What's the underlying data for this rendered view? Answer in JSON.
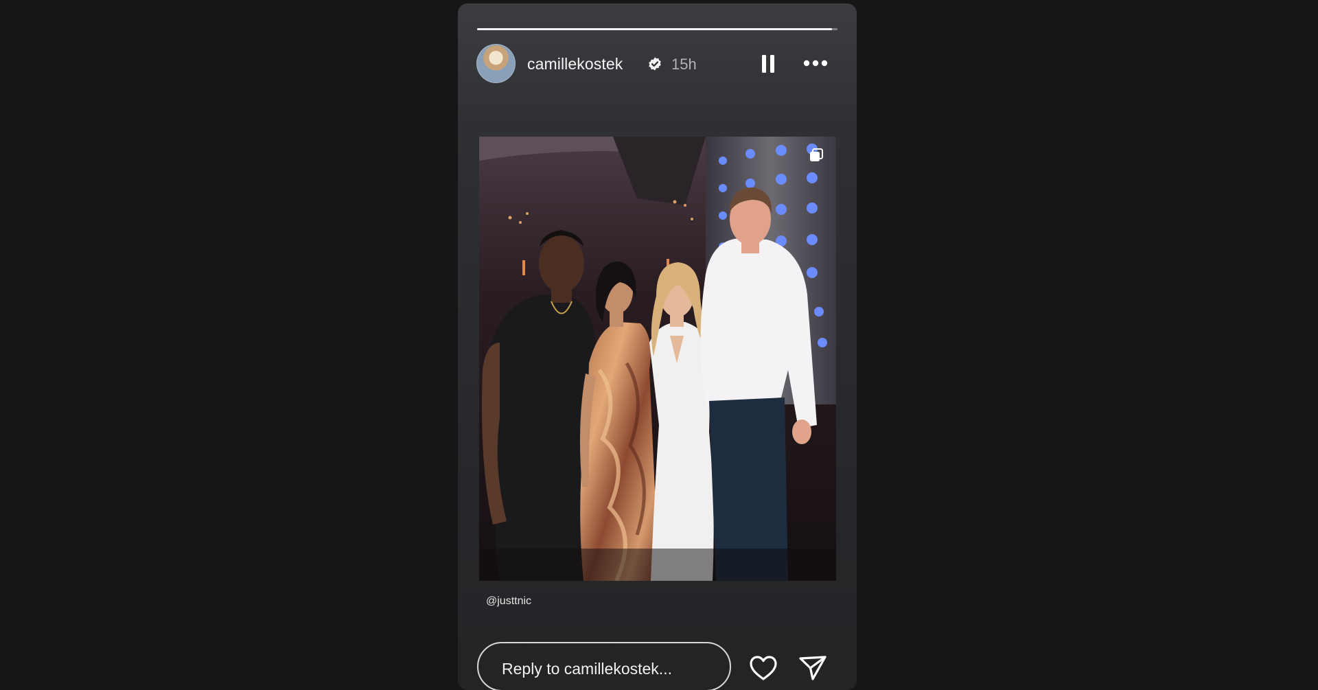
{
  "story": {
    "progress": 0.985,
    "username": "camillekostek",
    "verified": true,
    "timestamp": "15h",
    "caption": "@justtnic"
  },
  "controls": {
    "pause_icon": "pause-icon",
    "more_icon": "more-options-icon",
    "multi_photo_icon": "multiple-photos-icon"
  },
  "reply": {
    "placeholder": "Reply to camillekostek..."
  },
  "actions": {
    "like_icon": "heart-icon",
    "share_icon": "send-icon"
  },
  "colors": {
    "background": "#161616",
    "card_top": "#3c3d41",
    "card_bottom": "#232426",
    "text_primary": "#f5f5f5",
    "text_secondary": "#b4b4b6"
  }
}
